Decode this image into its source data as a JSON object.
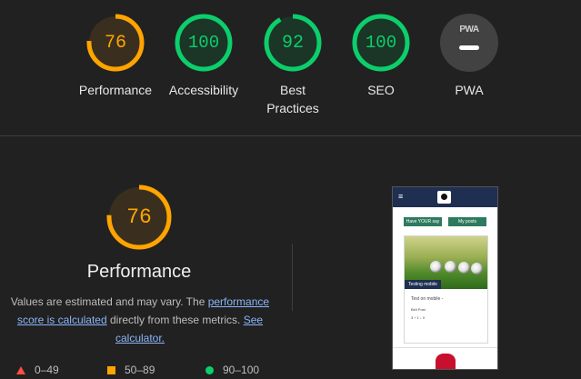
{
  "colors": {
    "average": "#ffa400",
    "good": "#0cce6b",
    "poor": "#ff4e42",
    "pwa": "#9e9e9e",
    "link": "#8ab4f8"
  },
  "categories": [
    {
      "label": "Performance",
      "score": "76",
      "fraction": 0.76,
      "status": "average"
    },
    {
      "label": "Accessibility",
      "score": "100",
      "fraction": 1.0,
      "status": "good"
    },
    {
      "label": "Best Practices",
      "label_line1": "Best",
      "label_line2": "Practices",
      "score": "92",
      "fraction": 0.92,
      "status": "good"
    },
    {
      "label": "SEO",
      "score": "100",
      "fraction": 1.0,
      "status": "good"
    },
    {
      "label": "PWA",
      "badge_text": "PWA",
      "icon": "pwa-badge-icon"
    }
  ],
  "performance": {
    "score": "76",
    "fraction": 0.76,
    "title": "Performance",
    "desc_prefix": "Values are estimated and may vary. The ",
    "desc_link1": "performance score is calculated",
    "desc_middle": " directly from these metrics. ",
    "desc_link2": "See calculator."
  },
  "legend": [
    {
      "range": "0–49",
      "icon": "triangle-icon"
    },
    {
      "range": "50–89",
      "icon": "square-icon"
    },
    {
      "range": "90–100",
      "icon": "circle-icon"
    }
  ],
  "screenshot": {
    "button1": "Have YOUR say",
    "button2": "My posts",
    "tag": "Testing mobile",
    "post_title": "Test on mobile -",
    "post_author": "Bell Post",
    "post_meta": "3 ↑ 1 ↓ 0"
  }
}
